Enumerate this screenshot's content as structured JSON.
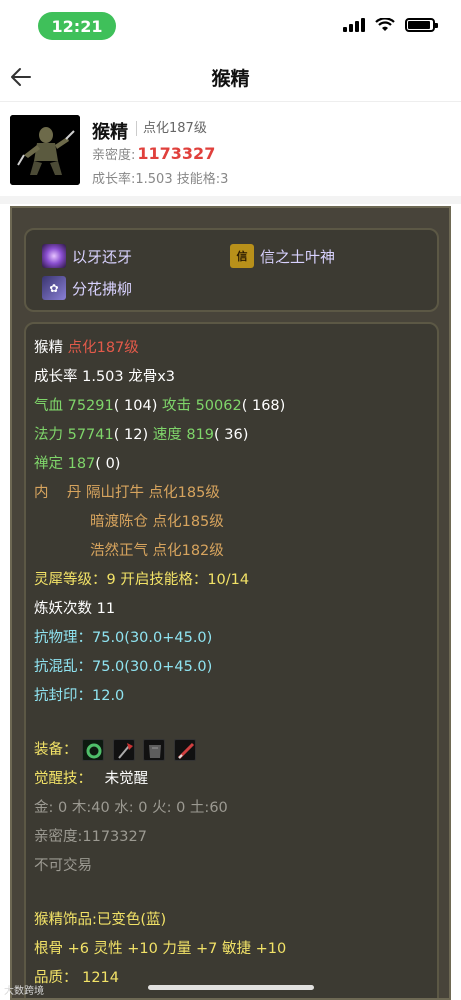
{
  "status_bar": {
    "time": "12:21"
  },
  "nav": {
    "title": "猴精"
  },
  "header": {
    "name": "猴精",
    "level": "点化187级",
    "intimacy_label": "亲密度:",
    "intimacy_value": "1173327",
    "growth": "成长率:1.503  技能格:3"
  },
  "skills": [
    {
      "name": "以牙还牙",
      "icon": "purple-orb-icon"
    },
    {
      "name": "信之土叶神",
      "icon": "xin-scroll-icon"
    },
    {
      "name": "分花拂柳",
      "icon": "flower-icon"
    }
  ],
  "info": {
    "name": "猴精",
    "level": "点化187级",
    "growth": "成长率 1.503 龙骨x3",
    "hp_label": "气血",
    "hp_value": "75291",
    "hp_extra": "( 104)",
    "atk_label": "攻击",
    "atk_value": "50062",
    "atk_extra": "( 168)",
    "mp_label": "法力",
    "mp_value": "57741",
    "mp_extra": "( 12)",
    "spd_label": "速度",
    "spd_value": "819",
    "spd_extra": "( 36)",
    "zen_label": "禅定",
    "zen_value": "187",
    "zen_extra": "( 0)",
    "neidan_label": "内    丹",
    "neidan_1": "隔山打牛 点化185级",
    "neidan_2": "暗渡陈仓 点化185级",
    "neidan_3": "浩然正气 点化182级",
    "lingxi": "灵犀等级：9 开启技能格：10/14",
    "lianyao": "炼妖次数 11",
    "resist_phys": "抗物理：75.0(30.0+45.0)",
    "resist_chaos": "抗混乱：75.0(30.0+45.0)",
    "resist_seal": "抗封印：12.0",
    "equip_label": "装备：",
    "awaken_label": "觉醒技：",
    "awaken_value": "未觉醒",
    "elements": "金: 0 木:40 水: 0 火: 0 土:60",
    "intimacy": "亲密度:1173327",
    "trade": "不可交易",
    "ornament": "猴精饰品:已变色(蓝)",
    "attrs": "根骨 +6 灵性 +10 力量 +7 敏捷 +10",
    "quality": "品质：  1214"
  },
  "equipment_icons": [
    "jade-ring-icon",
    "axe-icon",
    "armor-icon",
    "sword-icon"
  ],
  "watermark": "大数跨境",
  "colors": {
    "time_pill": "#3fc05a",
    "intimacy_red": "#e0403c",
    "panel_bg": "#48443a",
    "stat_green": "#7fd56a",
    "stat_yellow": "#f2e267",
    "stat_orange": "#d7a45e"
  }
}
